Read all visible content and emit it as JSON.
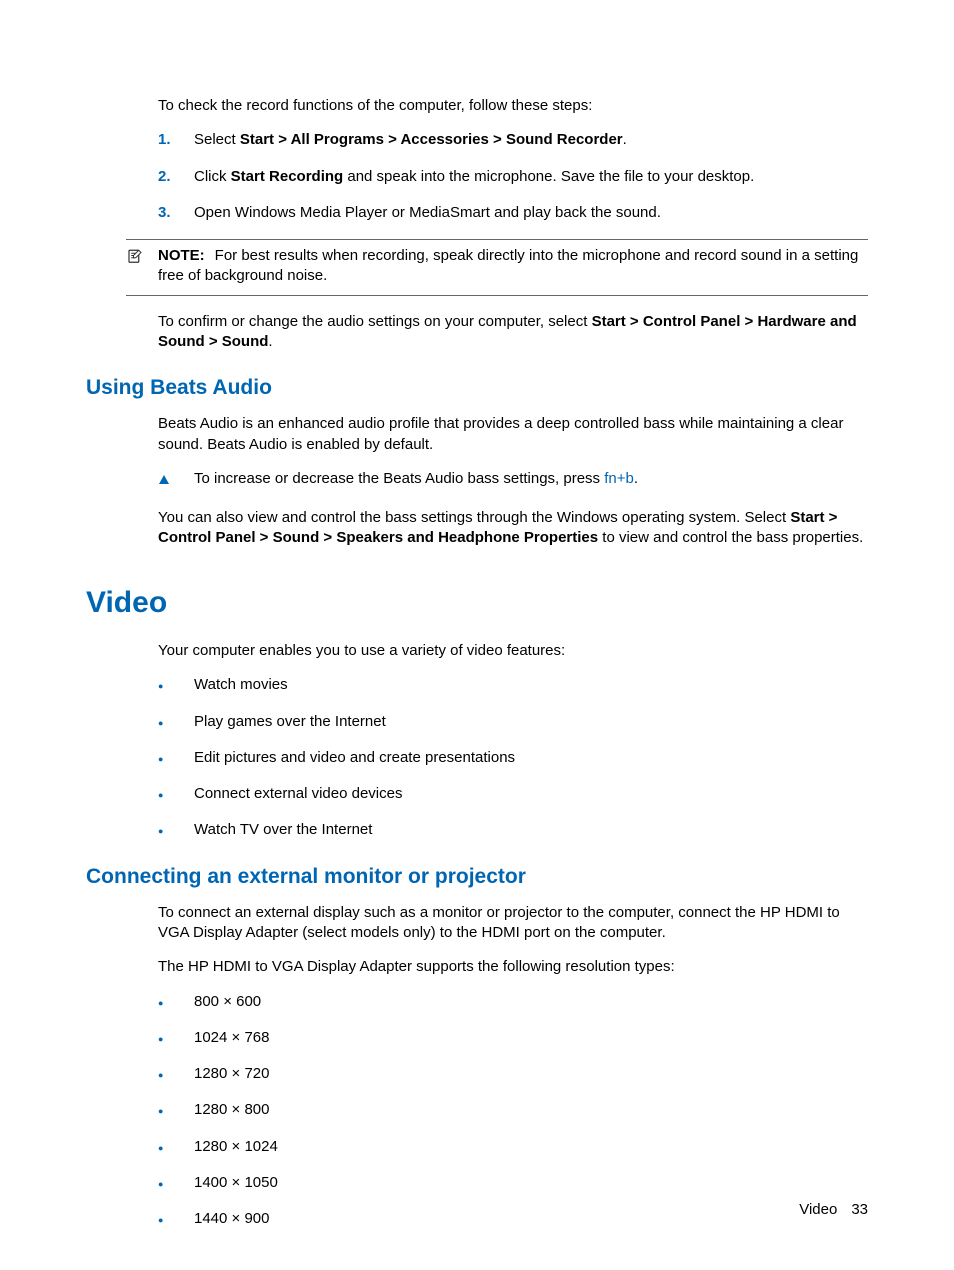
{
  "intro": "To check the record functions of the computer, follow these steps:",
  "steps": [
    {
      "n": "1.",
      "pre": "Select ",
      "bold": "Start > All Programs > Accessories > Sound Recorder",
      "post": "."
    },
    {
      "n": "2.",
      "pre": "Click ",
      "bold": "Start Recording",
      "post": " and speak into the microphone. Save the file to your desktop."
    },
    {
      "n": "3.",
      "pre": "Open Windows Media Player or MediaSmart and play back the sound.",
      "bold": "",
      "post": ""
    }
  ],
  "note": {
    "label": "NOTE:",
    "text": "For best results when recording, speak directly into the microphone and record sound in a setting free of background noise."
  },
  "confirm": {
    "pre": "To confirm or change the audio settings on your computer, select ",
    "bold": "Start > Control Panel > Hardware and Sound > Sound",
    "post": "."
  },
  "beats": {
    "heading": "Using Beats Audio",
    "intro": "Beats Audio is an enhanced audio profile that provides a deep controlled bass while maintaining a clear sound. Beats Audio is enabled by default.",
    "tip_pre": "To increase or decrease the Beats Audio bass settings, press ",
    "tip_key": "fn+b",
    "tip_post": ".",
    "view_pre": "You can also view and control the bass settings through the Windows operating system. Select ",
    "view_bold": "Start > Control Panel > Sound > Speakers and Headphone Properties",
    "view_post": " to view and control the bass properties."
  },
  "video": {
    "heading": "Video",
    "intro": "Your computer enables you to use a variety of video features:",
    "features": [
      "Watch movies",
      "Play games over the Internet",
      "Edit pictures and video and create presentations",
      "Connect external video devices",
      "Watch TV over the Internet"
    ]
  },
  "connect": {
    "heading": "Connecting an external monitor or projector",
    "p1": "To connect an external display such as a monitor or projector to the computer, connect the HP HDMI to VGA Display Adapter (select models only) to the HDMI port on the computer.",
    "p2": "The HP HDMI to VGA Display Adapter supports the following resolution types:",
    "res": [
      "800 × 600",
      "1024 × 768",
      "1280 × 720",
      "1280 × 800",
      "1280 × 1024",
      "1400 × 1050",
      "1440 × 900"
    ]
  },
  "footer": {
    "section": "Video",
    "page": "33"
  }
}
